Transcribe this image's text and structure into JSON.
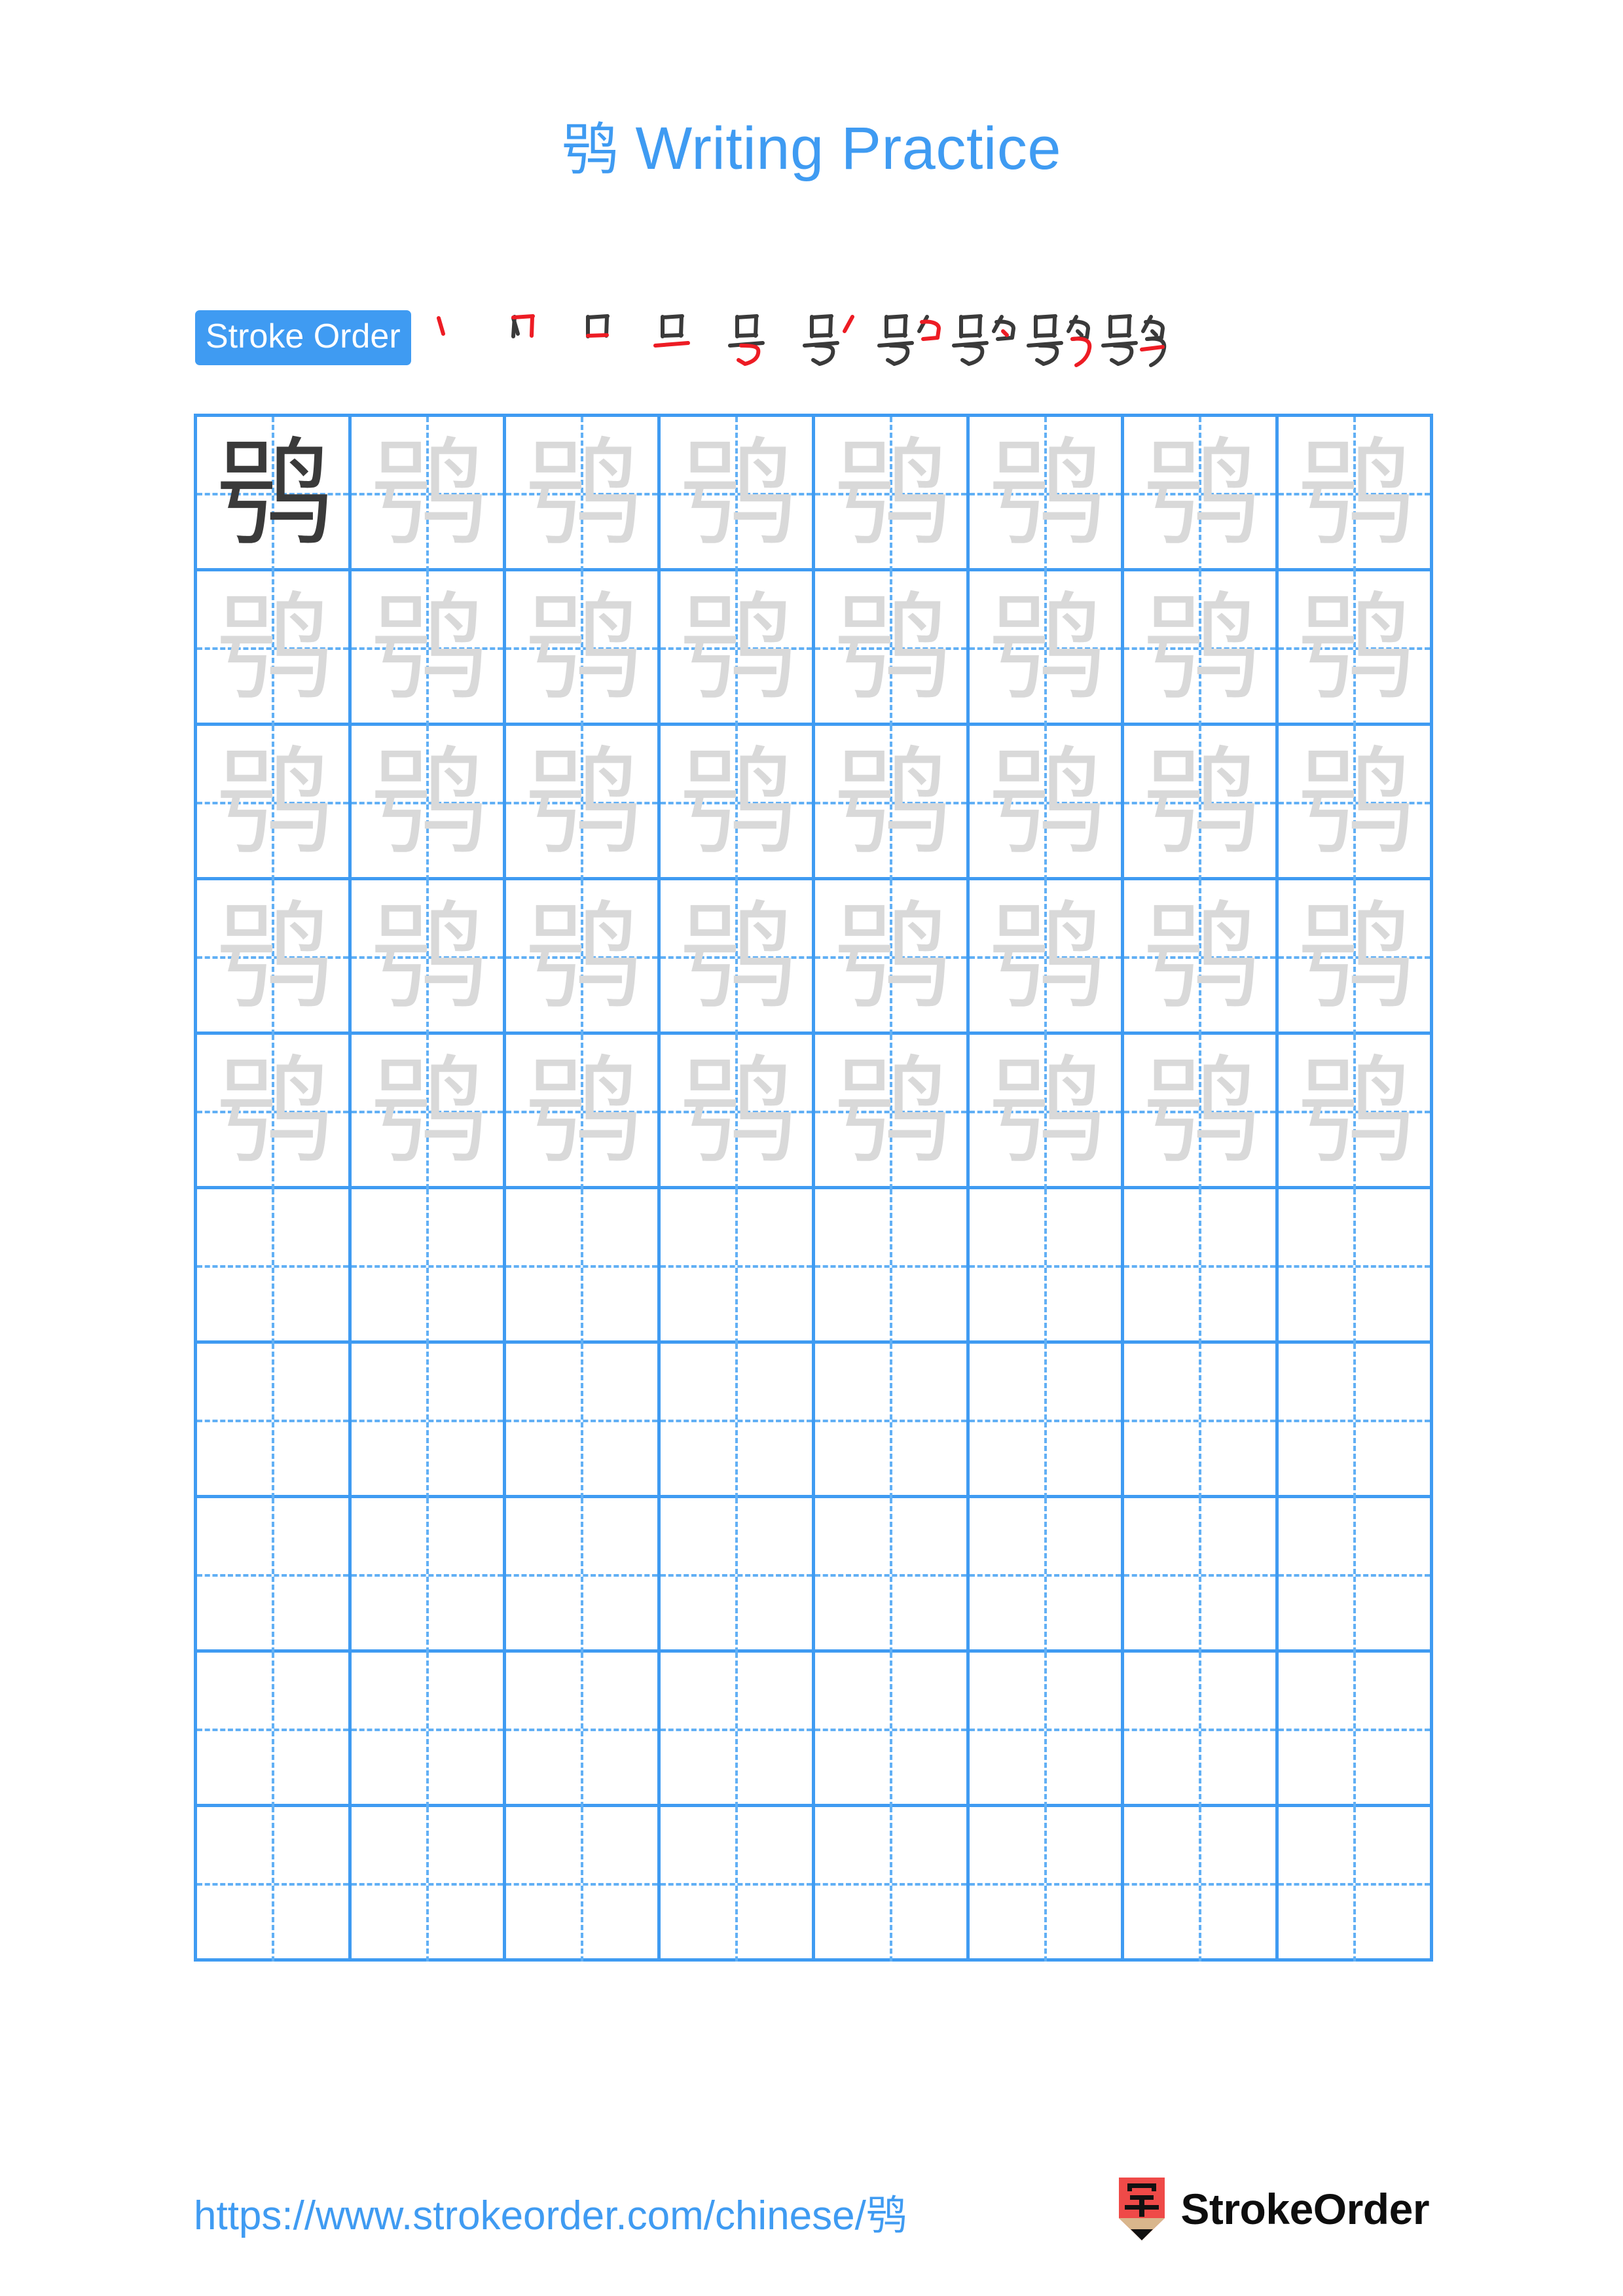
{
  "character": "鸮",
  "page": {
    "title_prefix": "鸮",
    "title_text": "Writing Practice",
    "background_color": "#ffffff"
  },
  "colors": {
    "accent_blue": "#3f9bf2",
    "grid_line": "#3f9bf2",
    "guide_dash": "#62b0f5",
    "ink_dark": "#3a3a3a",
    "ink_faded": "#d9d9d9",
    "new_stroke_red": "#ed1c24",
    "logo_red": "#ef4a48",
    "logo_wood": "#d9b68c",
    "logo_tip": "#111111"
  },
  "stroke_order": {
    "badge_label": "Stroke Order",
    "total_strokes": 10,
    "steps": [
      {
        "index": 1,
        "partial": "丶",
        "new_stroke": "dot"
      },
      {
        "index": 2,
        "partial": "丷",
        "new_stroke": "vertical-hook"
      },
      {
        "index": 3,
        "partial": "口",
        "new_stroke": "horizontal"
      },
      {
        "index": 4,
        "partial": "므",
        "new_stroke": "horizontal"
      },
      {
        "index": 5,
        "partial": "号",
        "new_stroke": "horizontal-bend-hook"
      },
      {
        "index": 6,
        "partial": "号丿",
        "new_stroke": "slant"
      },
      {
        "index": 7,
        "partial": "号勹",
        "new_stroke": "turn"
      },
      {
        "index": 8,
        "partial": "号勺",
        "new_stroke": "dot"
      },
      {
        "index": 9,
        "partial": "鸮",
        "new_stroke": "vertical-turn-hook"
      },
      {
        "index": 10,
        "partial": "鸮",
        "new_stroke": "horizontal"
      }
    ]
  },
  "grid": {
    "columns": 8,
    "rows": 10,
    "filled_rows": 5,
    "first_cell_style": "ink-dark",
    "traced_cell_style": "ink-faded",
    "cells": [
      {
        "row": 1,
        "col": 1,
        "char": "鸮",
        "style": "ink-dark"
      },
      {
        "row": 1,
        "col": 2,
        "char": "鸮",
        "style": "ink-faded"
      },
      {
        "row": 1,
        "col": 3,
        "char": "鸮",
        "style": "ink-faded"
      },
      {
        "row": 1,
        "col": 4,
        "char": "鸮",
        "style": "ink-faded"
      },
      {
        "row": 1,
        "col": 5,
        "char": "鸮",
        "style": "ink-faded"
      },
      {
        "row": 1,
        "col": 6,
        "char": "鸮",
        "style": "ink-faded"
      },
      {
        "row": 1,
        "col": 7,
        "char": "鸮",
        "style": "ink-faded"
      },
      {
        "row": 1,
        "col": 8,
        "char": "鸮",
        "style": "ink-faded"
      },
      {
        "row": 2,
        "col": 1,
        "char": "鸮",
        "style": "ink-faded"
      },
      {
        "row": 2,
        "col": 2,
        "char": "鸮",
        "style": "ink-faded"
      },
      {
        "row": 2,
        "col": 3,
        "char": "鸮",
        "style": "ink-faded"
      },
      {
        "row": 2,
        "col": 4,
        "char": "鸮",
        "style": "ink-faded"
      },
      {
        "row": 2,
        "col": 5,
        "char": "鸮",
        "style": "ink-faded"
      },
      {
        "row": 2,
        "col": 6,
        "char": "鸮",
        "style": "ink-faded"
      },
      {
        "row": 2,
        "col": 7,
        "char": "鸮",
        "style": "ink-faded"
      },
      {
        "row": 2,
        "col": 8,
        "char": "鸮",
        "style": "ink-faded"
      },
      {
        "row": 3,
        "col": 1,
        "char": "鸮",
        "style": "ink-faded"
      },
      {
        "row": 3,
        "col": 2,
        "char": "鸮",
        "style": "ink-faded"
      },
      {
        "row": 3,
        "col": 3,
        "char": "鸮",
        "style": "ink-faded"
      },
      {
        "row": 3,
        "col": 4,
        "char": "鸮",
        "style": "ink-faded"
      },
      {
        "row": 3,
        "col": 5,
        "char": "鸮",
        "style": "ink-faded"
      },
      {
        "row": 3,
        "col": 6,
        "char": "鸮",
        "style": "ink-faded"
      },
      {
        "row": 3,
        "col": 7,
        "char": "鸮",
        "style": "ink-faded"
      },
      {
        "row": 3,
        "col": 8,
        "char": "鸮",
        "style": "ink-faded"
      },
      {
        "row": 4,
        "col": 1,
        "char": "鸮",
        "style": "ink-faded"
      },
      {
        "row": 4,
        "col": 2,
        "char": "鸮",
        "style": "ink-faded"
      },
      {
        "row": 4,
        "col": 3,
        "char": "鸮",
        "style": "ink-faded"
      },
      {
        "row": 4,
        "col": 4,
        "char": "鸮",
        "style": "ink-faded"
      },
      {
        "row": 4,
        "col": 5,
        "char": "鸮",
        "style": "ink-faded"
      },
      {
        "row": 4,
        "col": 6,
        "char": "鸮",
        "style": "ink-faded"
      },
      {
        "row": 4,
        "col": 7,
        "char": "鸮",
        "style": "ink-faded"
      },
      {
        "row": 4,
        "col": 8,
        "char": "鸮",
        "style": "ink-faded"
      },
      {
        "row": 5,
        "col": 1,
        "char": "鸮",
        "style": "ink-faded"
      },
      {
        "row": 5,
        "col": 2,
        "char": "鸮",
        "style": "ink-faded"
      },
      {
        "row": 5,
        "col": 3,
        "char": "鸮",
        "style": "ink-faded"
      },
      {
        "row": 5,
        "col": 4,
        "char": "鸮",
        "style": "ink-faded"
      },
      {
        "row": 5,
        "col": 5,
        "char": "鸮",
        "style": "ink-faded"
      },
      {
        "row": 5,
        "col": 6,
        "char": "鸮",
        "style": "ink-faded"
      },
      {
        "row": 5,
        "col": 7,
        "char": "鸮",
        "style": "ink-faded"
      },
      {
        "row": 5,
        "col": 8,
        "char": "鸮",
        "style": "ink-faded"
      },
      {
        "row": 6,
        "col": 1,
        "char": "",
        "style": "empty"
      },
      {
        "row": 6,
        "col": 2,
        "char": "",
        "style": "empty"
      },
      {
        "row": 6,
        "col": 3,
        "char": "",
        "style": "empty"
      },
      {
        "row": 6,
        "col": 4,
        "char": "",
        "style": "empty"
      },
      {
        "row": 6,
        "col": 5,
        "char": "",
        "style": "empty"
      },
      {
        "row": 6,
        "col": 6,
        "char": "",
        "style": "empty"
      },
      {
        "row": 6,
        "col": 7,
        "char": "",
        "style": "empty"
      },
      {
        "row": 6,
        "col": 8,
        "char": "",
        "style": "empty"
      },
      {
        "row": 7,
        "col": 1,
        "char": "",
        "style": "empty"
      },
      {
        "row": 7,
        "col": 2,
        "char": "",
        "style": "empty"
      },
      {
        "row": 7,
        "col": 3,
        "char": "",
        "style": "empty"
      },
      {
        "row": 7,
        "col": 4,
        "char": "",
        "style": "empty"
      },
      {
        "row": 7,
        "col": 5,
        "char": "",
        "style": "empty"
      },
      {
        "row": 7,
        "col": 6,
        "char": "",
        "style": "empty"
      },
      {
        "row": 7,
        "col": 7,
        "char": "",
        "style": "empty"
      },
      {
        "row": 7,
        "col": 8,
        "char": "",
        "style": "empty"
      },
      {
        "row": 8,
        "col": 1,
        "char": "",
        "style": "empty"
      },
      {
        "row": 8,
        "col": 2,
        "char": "",
        "style": "empty"
      },
      {
        "row": 8,
        "col": 3,
        "char": "",
        "style": "empty"
      },
      {
        "row": 8,
        "col": 4,
        "char": "",
        "style": "empty"
      },
      {
        "row": 8,
        "col": 5,
        "char": "",
        "style": "empty"
      },
      {
        "row": 8,
        "col": 6,
        "char": "",
        "style": "empty"
      },
      {
        "row": 8,
        "col": 7,
        "char": "",
        "style": "empty"
      },
      {
        "row": 8,
        "col": 8,
        "char": "",
        "style": "empty"
      },
      {
        "row": 9,
        "col": 1,
        "char": "",
        "style": "empty"
      },
      {
        "row": 9,
        "col": 2,
        "char": "",
        "style": "empty"
      },
      {
        "row": 9,
        "col": 3,
        "char": "",
        "style": "empty"
      },
      {
        "row": 9,
        "col": 4,
        "char": "",
        "style": "empty"
      },
      {
        "row": 9,
        "col": 5,
        "char": "",
        "style": "empty"
      },
      {
        "row": 9,
        "col": 6,
        "char": "",
        "style": "empty"
      },
      {
        "row": 9,
        "col": 7,
        "char": "",
        "style": "empty"
      },
      {
        "row": 9,
        "col": 8,
        "char": "",
        "style": "empty"
      },
      {
        "row": 10,
        "col": 1,
        "char": "",
        "style": "empty"
      },
      {
        "row": 10,
        "col": 2,
        "char": "",
        "style": "empty"
      },
      {
        "row": 10,
        "col": 3,
        "char": "",
        "style": "empty"
      },
      {
        "row": 10,
        "col": 4,
        "char": "",
        "style": "empty"
      },
      {
        "row": 10,
        "col": 5,
        "char": "",
        "style": "empty"
      },
      {
        "row": 10,
        "col": 6,
        "char": "",
        "style": "empty"
      },
      {
        "row": 10,
        "col": 7,
        "char": "",
        "style": "empty"
      },
      {
        "row": 10,
        "col": 8,
        "char": "",
        "style": "empty"
      }
    ]
  },
  "footer": {
    "url": "https://www.strokeorder.com/chinese/鸮",
    "brand_name": "StrokeOrder",
    "logo_char": "字"
  }
}
